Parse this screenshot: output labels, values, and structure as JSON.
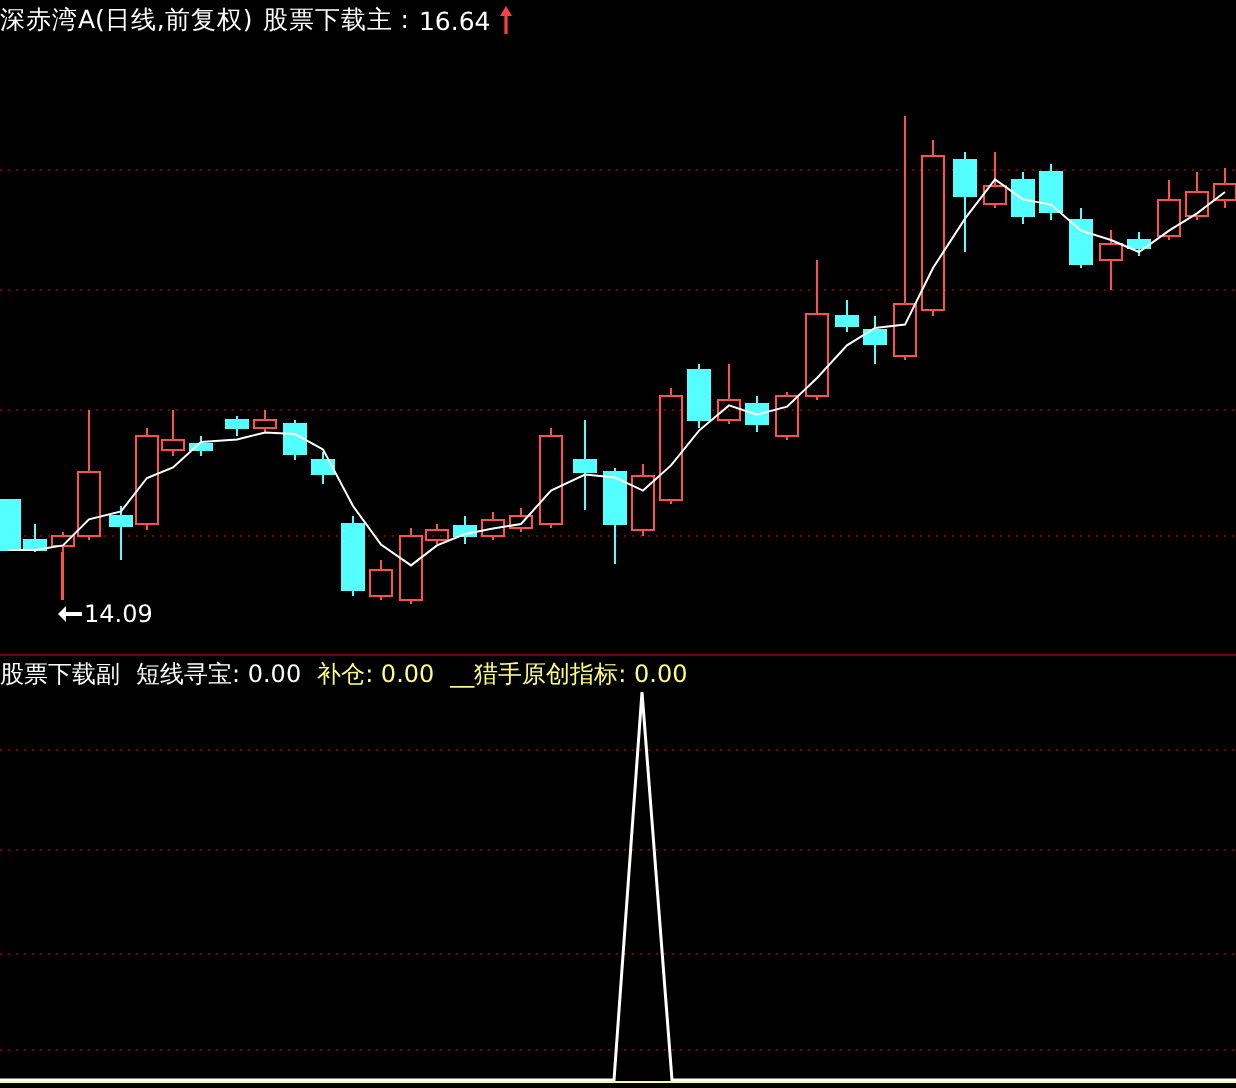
{
  "price_panel": {
    "stock_name": "深赤湾A(日线,前复权)",
    "indicator": "股票下载主 :",
    "max_price": "16.64",
    "min_price": "14.09"
  },
  "indicator_panel": {
    "name": "股票下载副",
    "legend": [
      {
        "label": "短线寻宝: 0.00",
        "color": "#ffffff"
      },
      {
        "label": "补仓: 0.00",
        "color": "#ffff80"
      },
      {
        "label": "__猎手原创指标: 0.00",
        "color": "#ffff80"
      }
    ]
  }
}
